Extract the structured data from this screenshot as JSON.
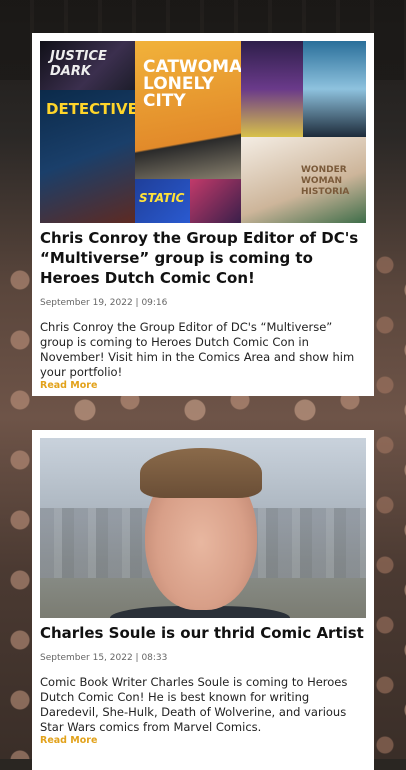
{
  "posts": [
    {
      "title": "Chris Conroy the Group Editor of DC's “Multiverse” group is coming to Heroes Dutch Comic Con!",
      "date": "September 19, 2022 | 09:16",
      "excerpt": "Chris Conroy the Group Editor of DC's “Multiverse” group is coming to Heroes Dutch Comic Con in November! Visit him in the Comics Area and show him your portfolio!",
      "read_more": "Read More",
      "image_text": {
        "justice": "JUSTICE DARK",
        "detective": "DETECTIVE",
        "catwoman": "CATWOMAN LONELY CITY",
        "historia": "WONDER WOMAN HISTORIA",
        "static": "STATIC"
      }
    },
    {
      "title": "Charles Soule is our thrid Comic Artist",
      "date": "September 15, 2022 | 08:33",
      "excerpt": "Comic Book Writer Charles Soule is coming to Heroes Dutch Comic Con! He is best known for writing Daredevil, She-Hulk, Death of Wolverine, and various Star Wars comics from Marvel Comics.",
      "read_more": "Read More"
    }
  ],
  "colors": {
    "accent": "#e2a21b",
    "card": "#ffffff",
    "text": "#111111"
  }
}
